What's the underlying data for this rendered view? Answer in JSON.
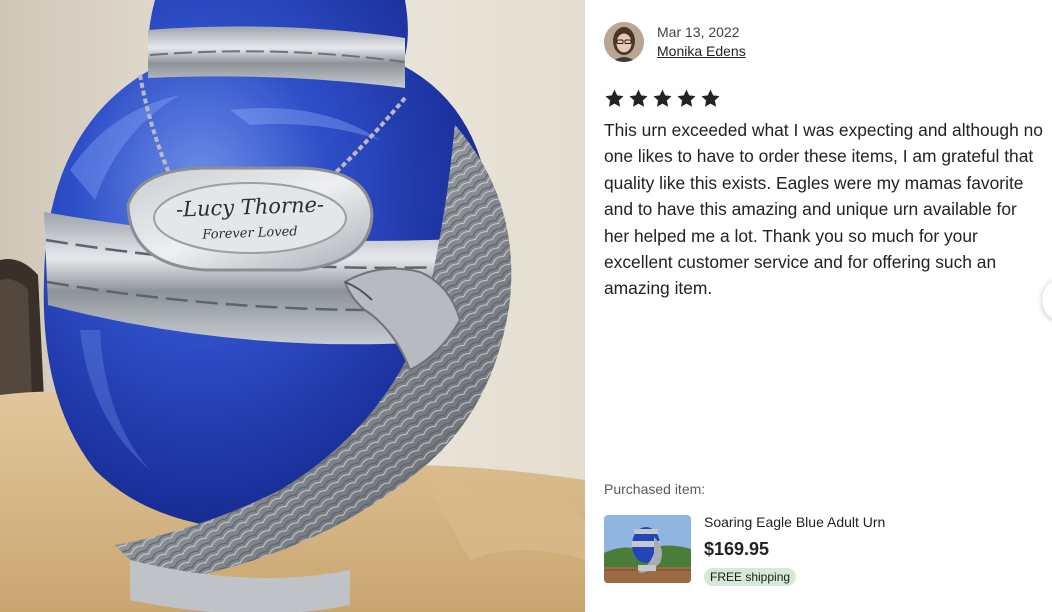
{
  "photo": {
    "plaque_name": "-Lucy Thorne-",
    "plaque_subtitle": "Forever Loved"
  },
  "review": {
    "date": "Mar 13, 2022",
    "reviewer_name": "Monika Edens",
    "rating": 5,
    "rating_max": 5,
    "text": "This urn exceeded what I was expecting and although no one likes to have to order these items, I am grateful that quality like this exists. Eagles were my mamas favorite and to have this amazing and unique urn available for her helped me a lot. Thank you so much for your excellent customer service and for offering such an amazing item.",
    "star_color": "#222222"
  },
  "purchase": {
    "label": "Purchased item:",
    "title": "Soaring Eagle Blue Adult Urn",
    "price": "$169.95",
    "shipping_badge": "FREE shipping",
    "badge_color": "#d4e9d7"
  },
  "icons": {
    "star": "star-icon",
    "next": "chevron-right-icon"
  }
}
